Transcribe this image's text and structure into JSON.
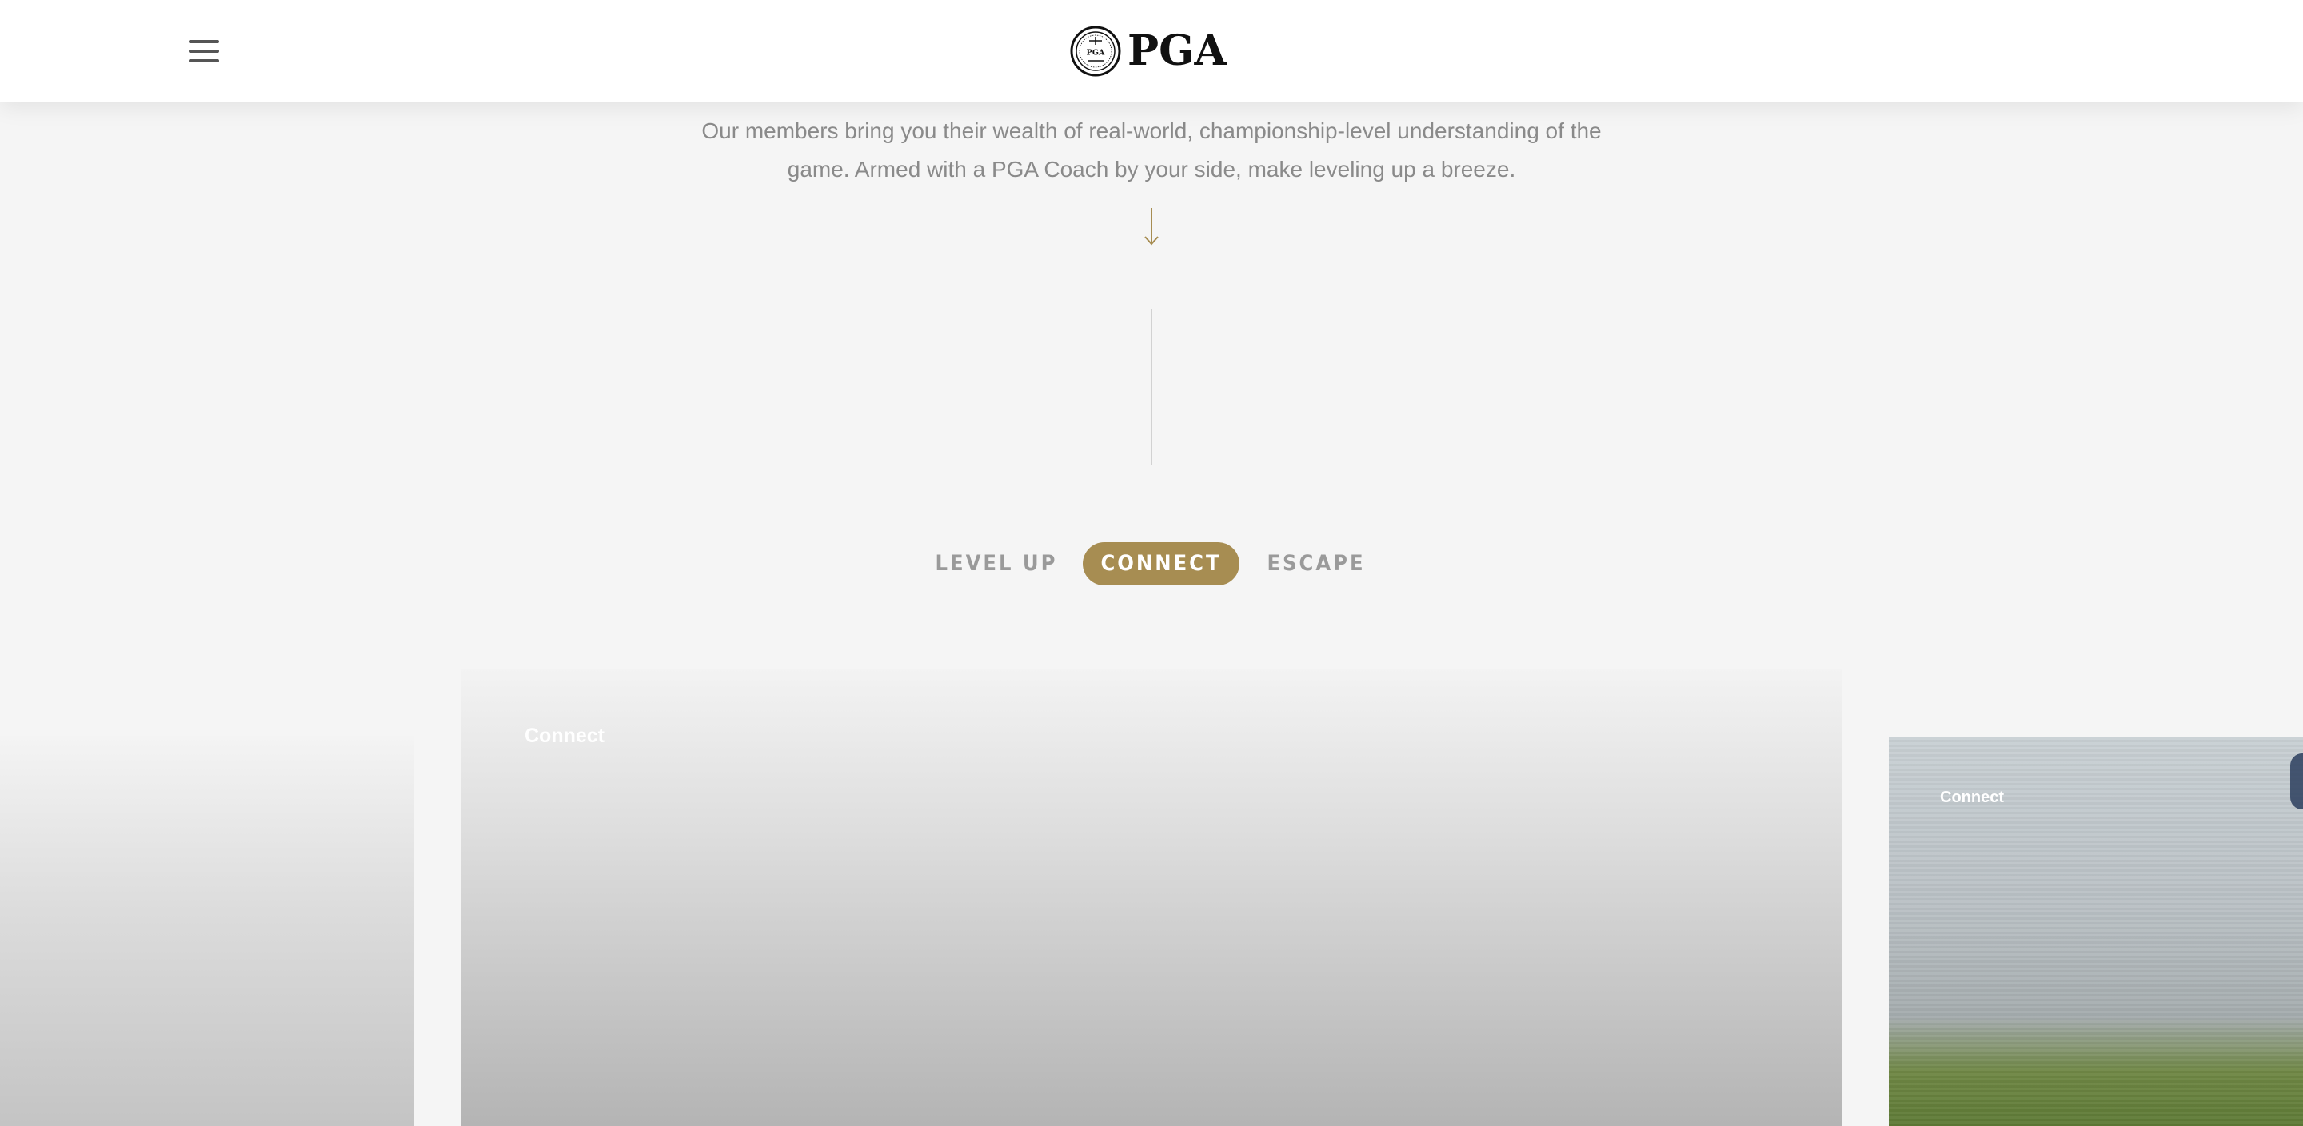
{
  "header": {
    "logo_text": "PGA",
    "menu_icon": "hamburger-menu-icon"
  },
  "intro": {
    "text": "Our members bring you their wealth of real-world, championship-level understanding of the game. Armed with a PGA Coach by your side, make leveling up a breeze."
  },
  "scroll_icon": "arrow-down-icon",
  "tabs": [
    {
      "label": "LEVEL UP",
      "active": false
    },
    {
      "label": "CONNECT",
      "active": true
    },
    {
      "label": "ESCAPE",
      "active": false
    }
  ],
  "cards": {
    "main": {
      "label": "Connect"
    },
    "right": {
      "label": "Connect"
    }
  },
  "colors": {
    "accent": "#a78d52",
    "background": "#f5f5f5",
    "text_muted": "#8a8a8a"
  }
}
